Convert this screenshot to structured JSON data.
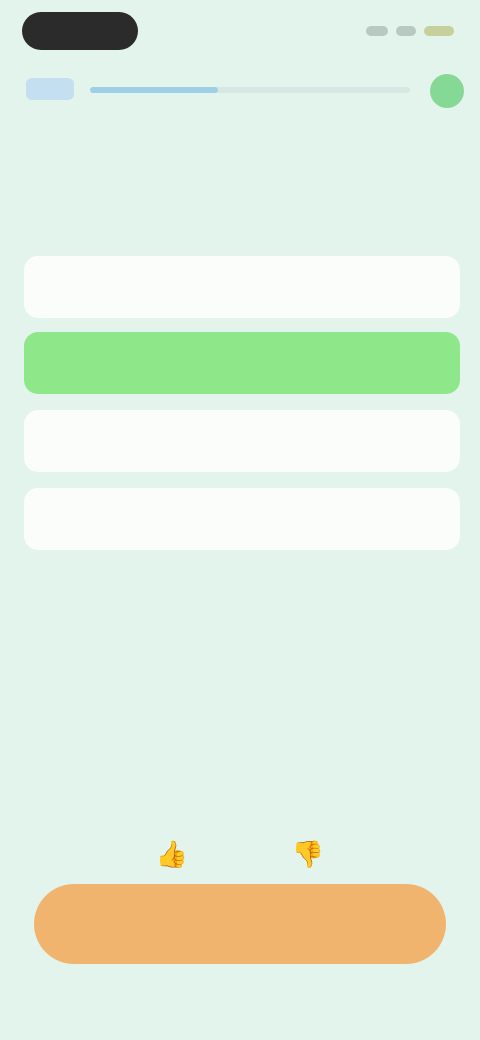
{
  "status_bar": {
    "time": "",
    "icons": [
      "signal-icon",
      "wifi-icon",
      "battery-icon"
    ]
  },
  "top_row": {
    "back_label": "",
    "progress": 0.4,
    "help_icon": "help-icon"
  },
  "question": {
    "text": ""
  },
  "options": [
    {
      "label": "",
      "selected": false
    },
    {
      "label": "",
      "selected": true
    },
    {
      "label": "",
      "selected": false
    },
    {
      "label": "",
      "selected": false
    }
  ],
  "explanation": {
    "heading": "",
    "text": ""
  },
  "feedback": {
    "thumbs_up_icon": "thumbs-up-icon",
    "thumbs_down_icon": "thumbs-down-icon"
  },
  "cta": {
    "label": ""
  },
  "colors": {
    "background": "#e2f4ec",
    "selected_option": "#8ee88a",
    "cta": "#f1b46e",
    "accent_label": "#e7a566",
    "help_dot": "#86d994"
  }
}
